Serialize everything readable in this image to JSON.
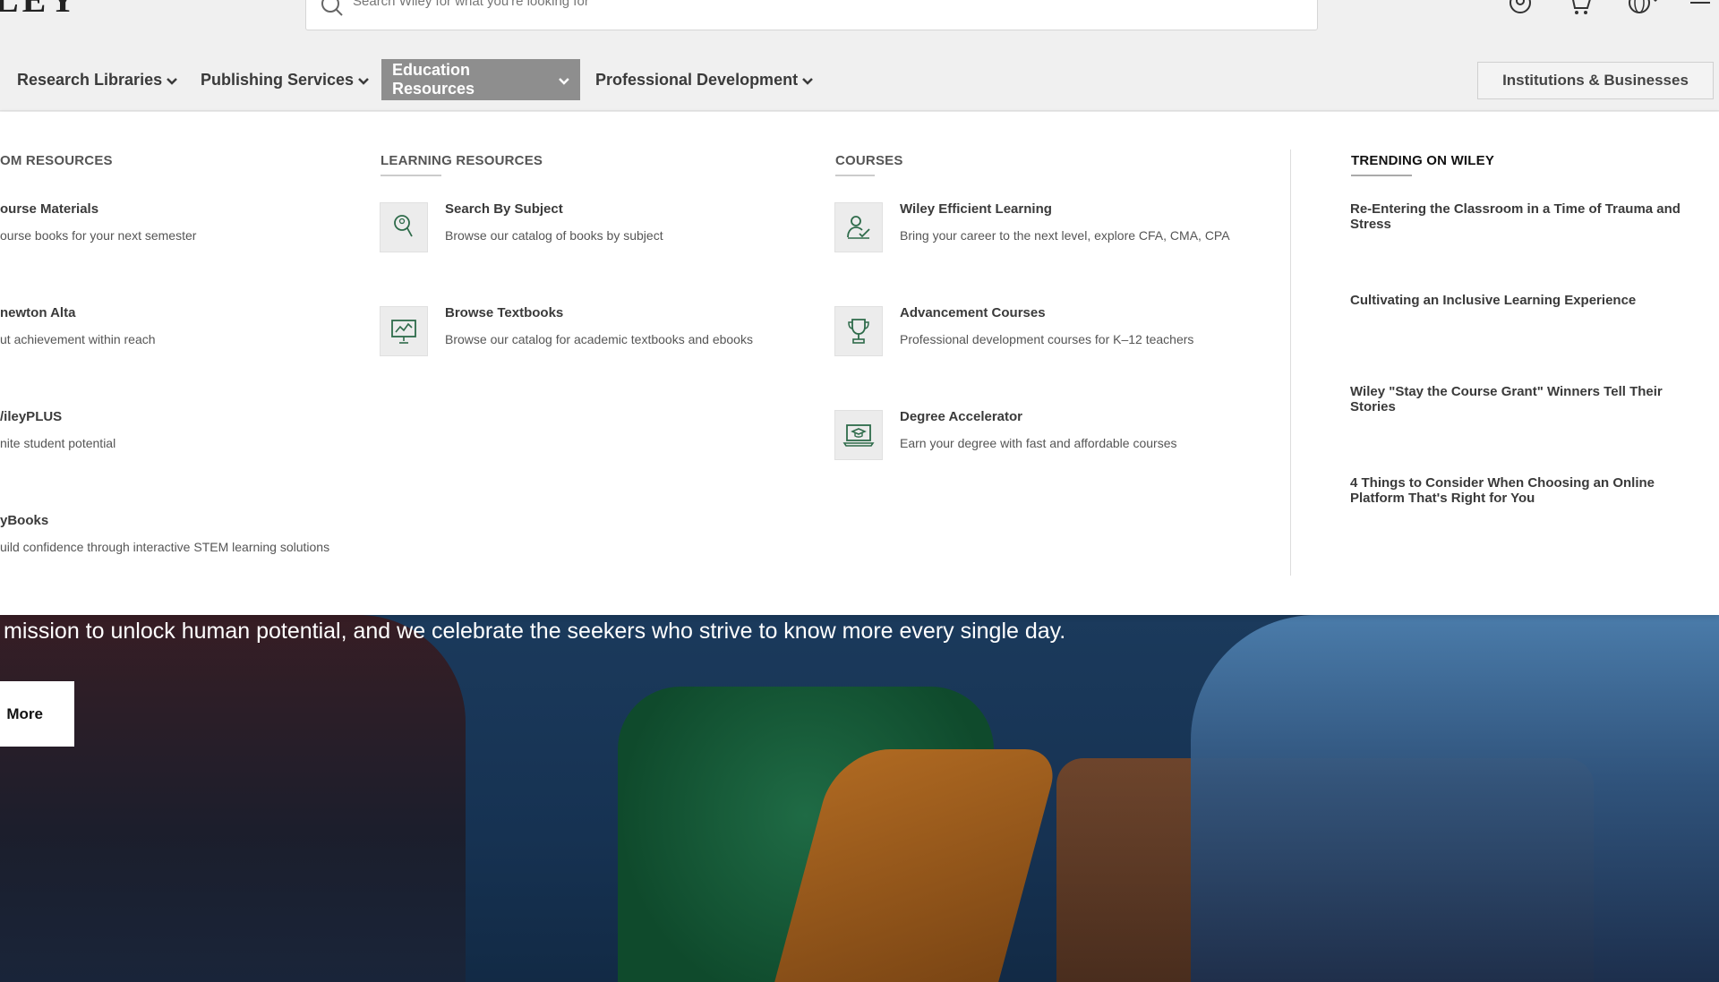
{
  "header": {
    "logo_text": "LEY",
    "search_placeholder": "Search Wiley for what you're looking for"
  },
  "nav": {
    "items": [
      {
        "label": "Research Libraries"
      },
      {
        "label": "Publishing Services"
      },
      {
        "label": "Education Resources"
      },
      {
        "label": "Professional Development"
      }
    ],
    "institutions_label": "Institutions & Businesses"
  },
  "menu": {
    "classroom": {
      "title": "OM RESOURCES",
      "items": [
        {
          "title": "ourse Materials",
          "desc": "ourse books for your next semester"
        },
        {
          "title": "newton Alta",
          "desc": "ut achievement within reach"
        },
        {
          "title": "/ileyPLUS",
          "desc": "nite student potential"
        },
        {
          "title": "yBooks",
          "desc": "uild confidence through interactive STEM learning solutions"
        }
      ]
    },
    "learning": {
      "title": "LEARNING RESOURCES",
      "items": [
        {
          "title": "Search By Subject",
          "desc": "Browse our catalog of books by subject",
          "icon": "search-person-icon"
        },
        {
          "title": "Browse Textbooks",
          "desc": "Browse our catalog for academic textbooks and ebooks",
          "icon": "presentation-chart-icon"
        }
      ]
    },
    "courses": {
      "title": "COURSES",
      "items": [
        {
          "title": "Wiley Efficient Learning",
          "desc": "Bring your career to the next level, explore CFA, CMA, CPA",
          "icon": "learner-check-icon"
        },
        {
          "title": "Advancement Courses",
          "desc": "Professional development courses for K–12 teachers",
          "icon": "trophy-icon"
        },
        {
          "title": "Degree Accelerator",
          "desc": "Earn your degree with fast and affordable courses",
          "icon": "laptop-graduation-icon"
        }
      ]
    },
    "trending": {
      "title": "TRENDING ON WILEY",
      "items": [
        {
          "label": "Re-Entering the Classroom in a Time of Trauma and Stress"
        },
        {
          "label": "Cultivating an Inclusive Learning Experience"
        },
        {
          "label": "Wiley \"Stay the Course Grant\" Winners Tell Their Stories"
        },
        {
          "label": "4 Things to Consider When Choosing an Online Platform That's Right for You"
        }
      ]
    }
  },
  "hero": {
    "text": "mission to unlock human potential, and we celebrate the seekers who strive to know more every single day.",
    "button_label": "More"
  },
  "colors": {
    "accent_green": "#2e6b4a",
    "active_nav_bg": "#8e8e8e"
  }
}
